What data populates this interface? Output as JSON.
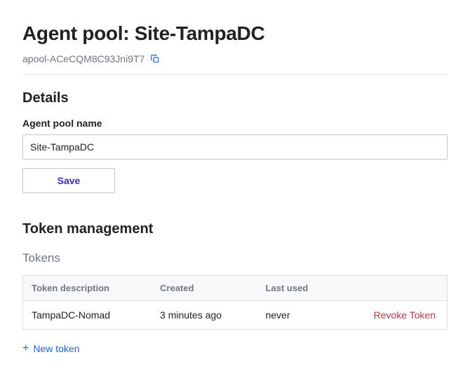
{
  "header": {
    "title_prefix": "Agent pool: ",
    "pool_name": "Site-TampaDC",
    "pool_id": "apool-ACeCQM8C93Jni9T7"
  },
  "details": {
    "heading": "Details",
    "name_label": "Agent pool name",
    "name_value": "Site-TampaDC",
    "save_label": "Save"
  },
  "tokens": {
    "heading": "Token management",
    "sub_heading": "Tokens",
    "columns": {
      "description": "Token description",
      "created": "Created",
      "last_used": "Last used"
    },
    "rows": [
      {
        "description": "TampaDC-Nomad",
        "created": "3 minutes ago",
        "last_used": "never",
        "revoke_label": "Revoke Token"
      }
    ],
    "new_token_label": "New token"
  }
}
